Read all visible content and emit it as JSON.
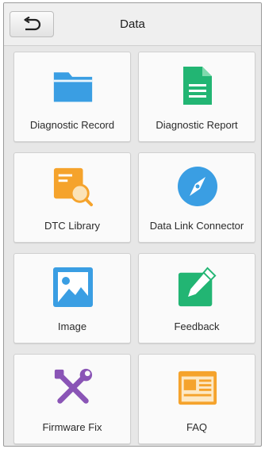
{
  "header": {
    "title": "Data"
  },
  "tiles": [
    {
      "label": "Diagnostic Record",
      "icon": "folder-icon",
      "color": "#3a9ee3"
    },
    {
      "label": "Diagnostic Report",
      "icon": "document-icon",
      "color": "#22b573"
    },
    {
      "label": "DTC Library",
      "icon": "dtc-library-icon",
      "color": "#f5a32c"
    },
    {
      "label": "Data Link Connector",
      "icon": "compass-icon",
      "color": "#3a9ee3"
    },
    {
      "label": "Image",
      "icon": "image-icon",
      "color": "#3a9ee3"
    },
    {
      "label": "Feedback",
      "icon": "edit-pencil-icon",
      "color": "#22b573"
    },
    {
      "label": "Firmware Fix",
      "icon": "tools-icon",
      "color": "#8a55b6"
    },
    {
      "label": "FAQ",
      "icon": "faq-news-icon",
      "color": "#f5a32c"
    }
  ]
}
